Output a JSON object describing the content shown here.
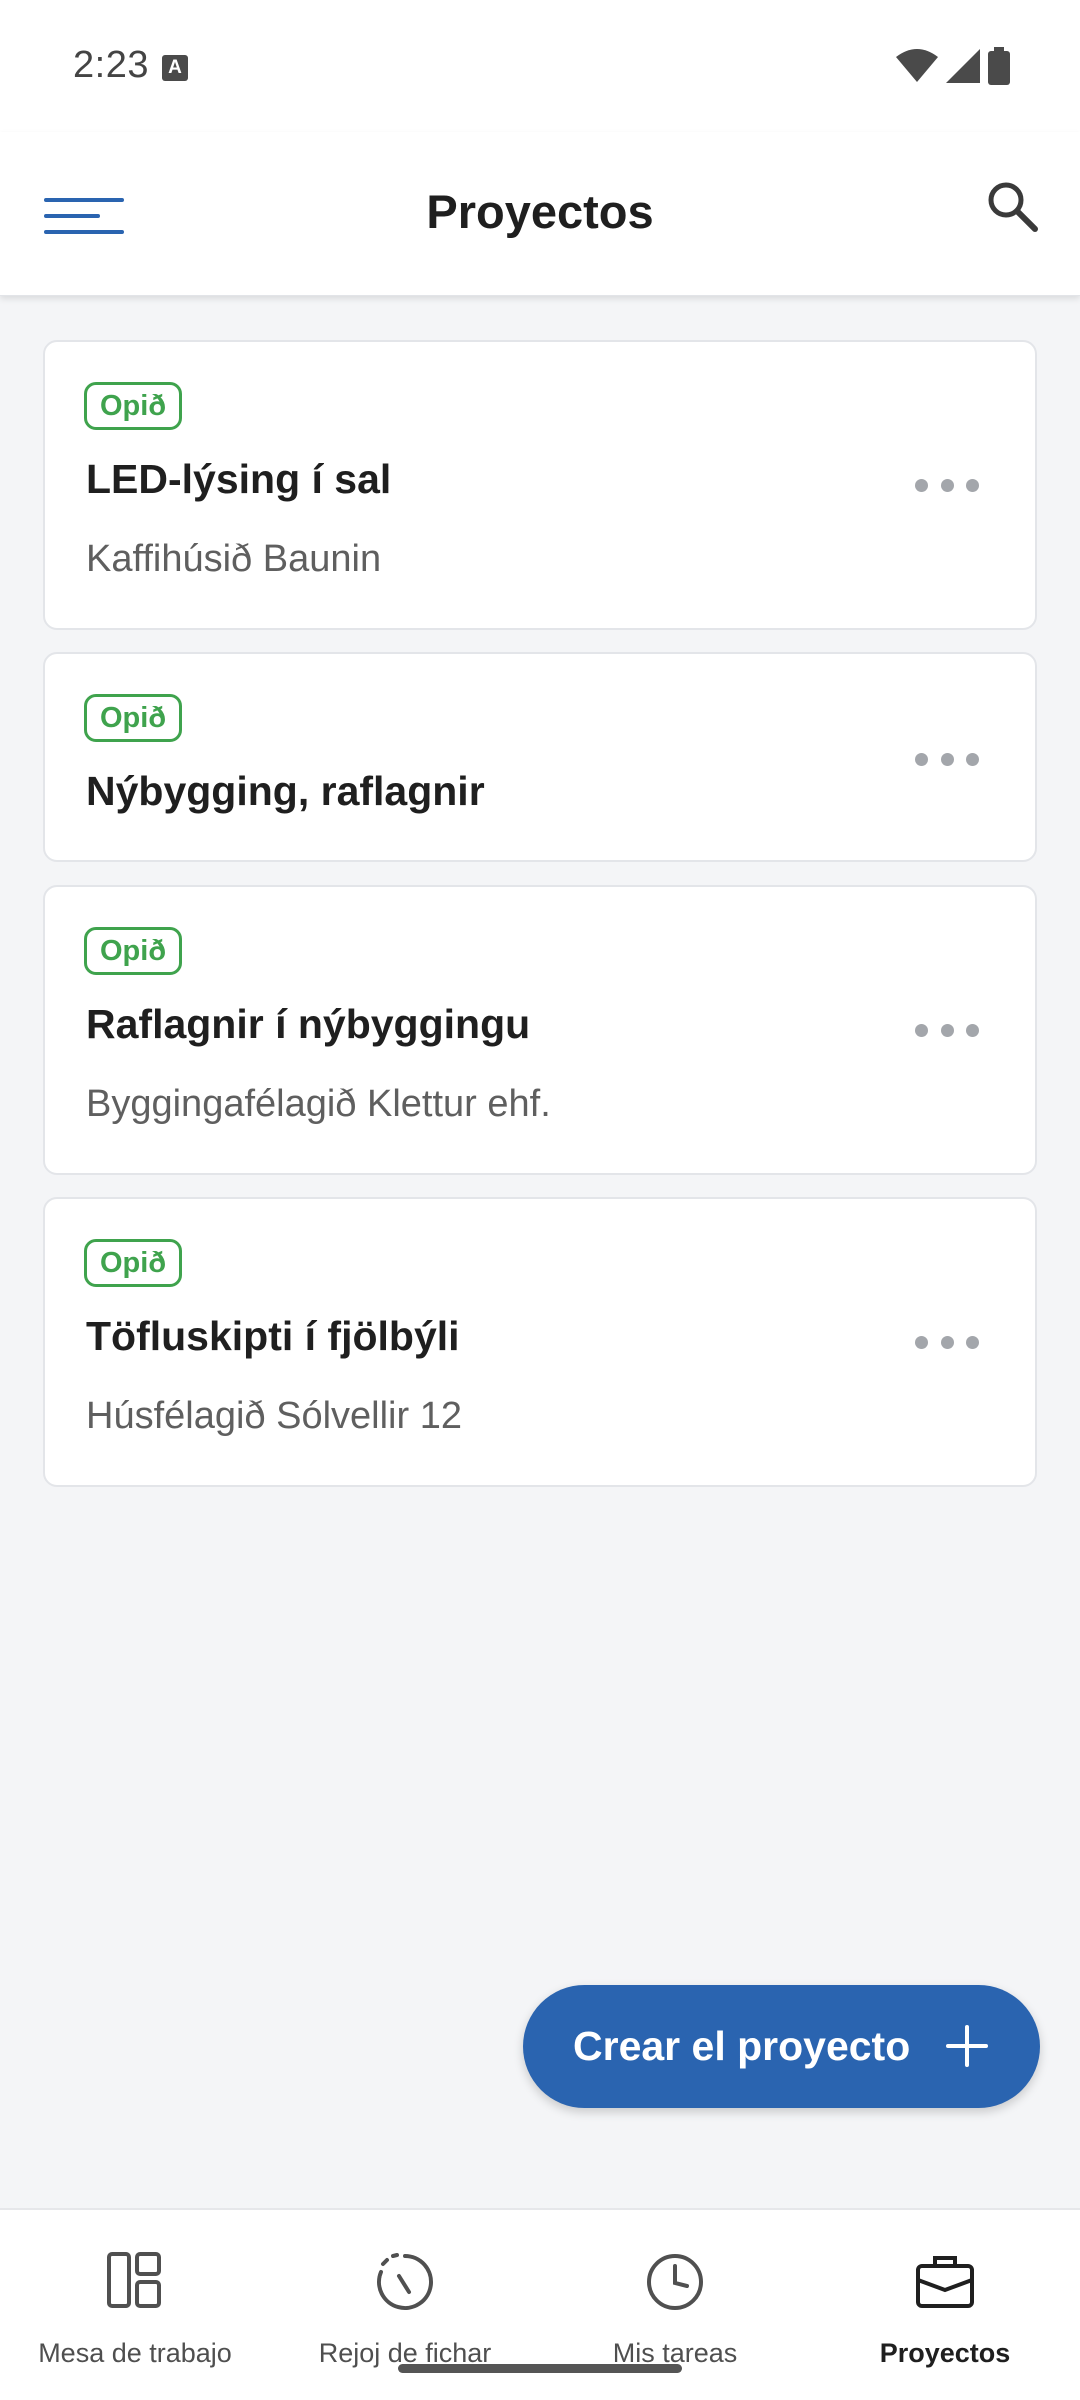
{
  "status_bar": {
    "time": "2:23",
    "notification_icon": "text-a-icon",
    "icons": [
      "wifi-icon",
      "cell-signal-icon",
      "battery-icon"
    ]
  },
  "app_bar": {
    "title": "Proyectos",
    "menu_icon": "hamburger-menu-icon",
    "search_icon": "search-icon"
  },
  "projects": [
    {
      "status": "Opið",
      "title": "LED-lýsing í sal",
      "client": "Kaffihúsið Baunin"
    },
    {
      "status": "Opið",
      "title": "Nýbygging, raflagnir",
      "client": ""
    },
    {
      "status": "Opið",
      "title": "Raflagnir í nýbyggingu",
      "client": "Byggingafélagið Klettur ehf."
    },
    {
      "status": "Opið",
      "title": "Töfluskipti í fjölbýli",
      "client": "Húsfélagið Sólvellir 12"
    }
  ],
  "fab": {
    "label": "Crear el proyecto",
    "icon": "plus-icon"
  },
  "bottom_nav": [
    {
      "label": "Mesa de trabajo",
      "icon": "dashboard-icon",
      "active": false
    },
    {
      "label": "Rejoj de fichar",
      "icon": "time-clock-icon",
      "active": false
    },
    {
      "label": "Mis tareas",
      "icon": "clock-icon",
      "active": false
    },
    {
      "label": "Proyectos",
      "icon": "briefcase-icon",
      "active": true
    }
  ],
  "colors": {
    "accent": "#2a64b0",
    "status_open": "#3fa34d",
    "background": "#f4f5f7"
  }
}
